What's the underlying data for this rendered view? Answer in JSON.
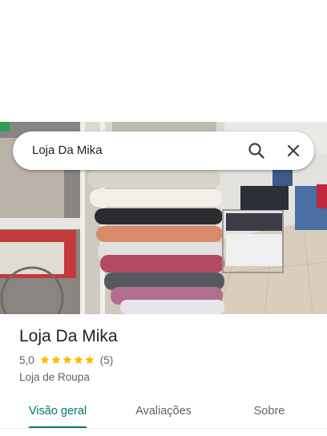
{
  "search": {
    "query": "Loja Da Mika"
  },
  "place": {
    "name": "Loja Da Mika",
    "rating": "5,0",
    "rating_value": 5.0,
    "rating_max": 5,
    "review_count": "(5)",
    "category": "Loja de Roupa",
    "star_color": "#fbbc04"
  },
  "tabs": [
    {
      "label": "Visão geral",
      "active": true
    },
    {
      "label": "Avaliações",
      "active": false
    },
    {
      "label": "Sobre",
      "active": false
    }
  ],
  "colors": {
    "accent": "#00796b"
  },
  "icons": {
    "search": "search-icon",
    "close": "close-icon",
    "star": "star-icon"
  }
}
